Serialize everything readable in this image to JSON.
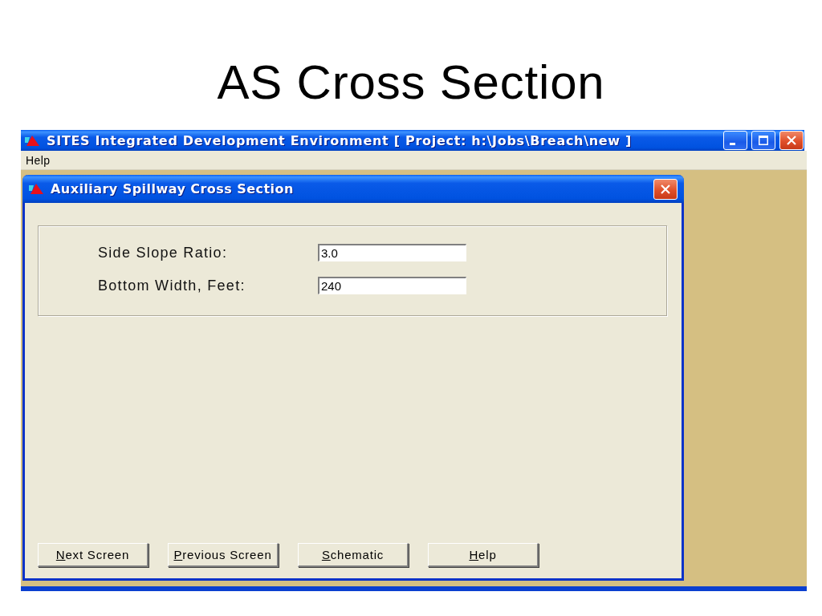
{
  "slide_title": "AS Cross Section",
  "app_window": {
    "title": "SITES Integrated Development Environment [ Project: h:\\Jobs\\Breach\\new ]",
    "menu": [
      "Help"
    ]
  },
  "dialog": {
    "title": "Auxiliary Spillway Cross Section",
    "fields": [
      {
        "label": "Side Slope Ratio:",
        "value": "3.0"
      },
      {
        "label": "Bottom Width, Feet:",
        "value": "240"
      }
    ],
    "buttons": [
      {
        "label": "Next Screen",
        "first_letter_underlined": true
      },
      {
        "label": "Previous Screen",
        "first_letter_underlined": true
      },
      {
        "label": "Schematic",
        "first_letter_underlined": true
      },
      {
        "label": "Help",
        "first_letter_underlined": true
      }
    ]
  }
}
